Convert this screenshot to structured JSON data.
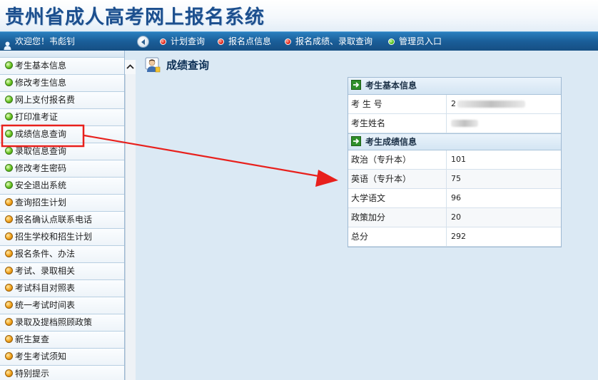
{
  "header": {
    "title": "贵州省成人高考网上报名系统"
  },
  "navbar": {
    "welcome": "欢迎您！韦彪钊",
    "items": [
      {
        "label": "计划查询",
        "dot": "red"
      },
      {
        "label": "报名点信息",
        "dot": "red"
      },
      {
        "label": "报名成绩、录取查询",
        "dot": "red"
      },
      {
        "label": "管理员入口",
        "dot": "green"
      }
    ]
  },
  "sidebar": {
    "items": [
      {
        "label": "考生基本信息",
        "dot": "green"
      },
      {
        "label": "修改考生信息",
        "dot": "green"
      },
      {
        "label": "网上支付报名费",
        "dot": "green"
      },
      {
        "label": "打印准考证",
        "dot": "green"
      },
      {
        "label": "成绩信息查询",
        "dot": "green"
      },
      {
        "label": "录取信息查询",
        "dot": "green"
      },
      {
        "label": "修改考生密码",
        "dot": "green"
      },
      {
        "label": "安全退出系统",
        "dot": "green"
      },
      {
        "label": "查询招生计划",
        "dot": "orange"
      },
      {
        "label": "报名确认点联系电话",
        "dot": "orange"
      },
      {
        "label": "招生学校和招生计划",
        "dot": "orange"
      },
      {
        "label": "报名条件、办法",
        "dot": "orange"
      },
      {
        "label": "考试、录取相关",
        "dot": "orange"
      },
      {
        "label": "考试科目对照表",
        "dot": "orange"
      },
      {
        "label": "统一考试时间表",
        "dot": "orange"
      },
      {
        "label": "录取及提档照顾政策",
        "dot": "orange"
      },
      {
        "label": "新生复查",
        "dot": "orange"
      },
      {
        "label": "考生考试须知",
        "dot": "orange"
      },
      {
        "label": "特别提示",
        "dot": "orange"
      }
    ]
  },
  "main": {
    "title": "成绩查询",
    "basic_section": {
      "heading": "考生基本信息",
      "rows": [
        {
          "label": "考 生 号",
          "value": "2"
        },
        {
          "label": "考生姓名",
          "value": ""
        }
      ]
    },
    "score_section": {
      "heading": "考生成绩信息",
      "rows": [
        {
          "label": "政治（专升本）",
          "value": "101"
        },
        {
          "label": "英语（专升本）",
          "value": "75"
        },
        {
          "label": "大学语文",
          "value": "96"
        },
        {
          "label": "政策加分",
          "value": "20"
        },
        {
          "label": "总分",
          "value": "292"
        }
      ]
    }
  },
  "colors": {
    "brand_blue": "#1c4f8e",
    "nav_blue": "#1a5e99",
    "annotation_red": "#e8201c"
  }
}
